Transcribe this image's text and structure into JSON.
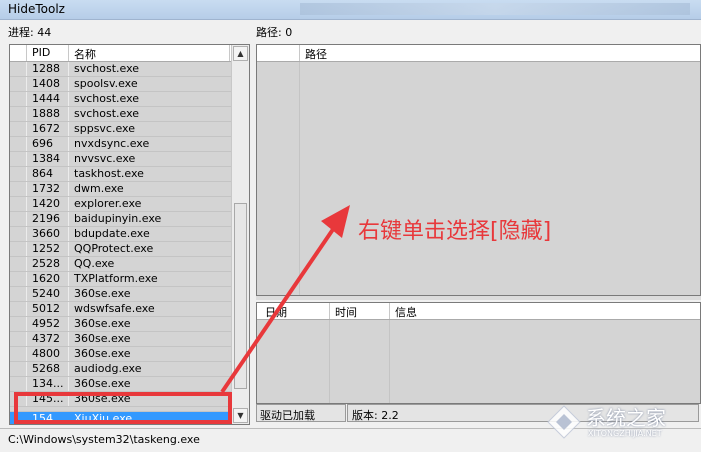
{
  "window": {
    "title": "HideToolz"
  },
  "left": {
    "process_count_label": "进程: 44",
    "columns": {
      "pid": "PID",
      "name": "名称"
    },
    "rows": [
      {
        "pid": "1288",
        "name": "svchost.exe"
      },
      {
        "pid": "1408",
        "name": "spoolsv.exe"
      },
      {
        "pid": "1444",
        "name": "svchost.exe"
      },
      {
        "pid": "1888",
        "name": "svchost.exe"
      },
      {
        "pid": "1672",
        "name": "sppsvc.exe"
      },
      {
        "pid": "696",
        "name": "nvxdsync.exe"
      },
      {
        "pid": "1384",
        "name": "nvvsvc.exe"
      },
      {
        "pid": "864",
        "name": "taskhost.exe"
      },
      {
        "pid": "1732",
        "name": "dwm.exe"
      },
      {
        "pid": "1420",
        "name": "explorer.exe"
      },
      {
        "pid": "2196",
        "name": "baidupinyin.exe"
      },
      {
        "pid": "3660",
        "name": "bdupdate.exe"
      },
      {
        "pid": "1252",
        "name": "QQProtect.exe"
      },
      {
        "pid": "2528",
        "name": "QQ.exe"
      },
      {
        "pid": "1620",
        "name": "TXPlatform.exe"
      },
      {
        "pid": "5240",
        "name": "360se.exe"
      },
      {
        "pid": "5012",
        "name": "wdswfsafe.exe"
      },
      {
        "pid": "4952",
        "name": "360se.exe"
      },
      {
        "pid": "4372",
        "name": "360se.exe"
      },
      {
        "pid": "4800",
        "name": "360se.exe"
      },
      {
        "pid": "5268",
        "name": "audiodg.exe"
      },
      {
        "pid": "134...",
        "name": "360se.exe"
      },
      {
        "pid": "145...",
        "name": "360se.exe"
      }
    ],
    "selected_row": {
      "pid": "154...",
      "name": "XiuXiu.exe"
    }
  },
  "right": {
    "path_count_label": "路径: 0",
    "path_column": "路径",
    "log_columns": {
      "date": "日期",
      "time": "时间",
      "info": "信息"
    }
  },
  "statusbar": {
    "path": "C:\\Windows\\system32\\taskeng.exe",
    "driver": "驱动已加载",
    "version": "版本: 2.2"
  },
  "annotation": {
    "text": "右键单击选择[隐藏]",
    "color": "#e8383b"
  },
  "watermark": {
    "text": "系统之家",
    "sub": "XITONGZHIJIA.NET"
  }
}
